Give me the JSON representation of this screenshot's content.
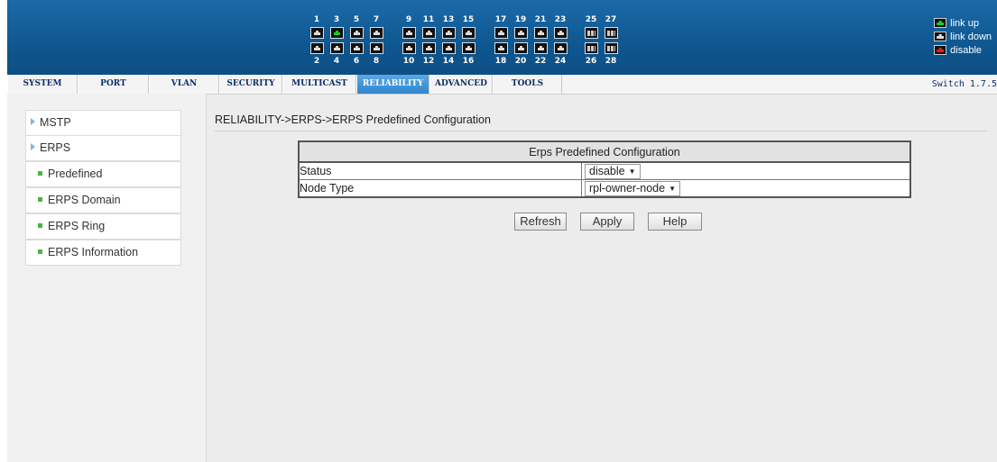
{
  "header": {
    "ports_top": [
      {
        "num": "1",
        "state": "down"
      },
      {
        "num": "3",
        "state": "up"
      },
      {
        "num": "5",
        "state": "down"
      },
      {
        "num": "7",
        "state": "down"
      },
      {
        "num": "9",
        "state": "down"
      },
      {
        "num": "11",
        "state": "down"
      },
      {
        "num": "13",
        "state": "down"
      },
      {
        "num": "15",
        "state": "down"
      },
      {
        "num": "17",
        "state": "down"
      },
      {
        "num": "19",
        "state": "down"
      },
      {
        "num": "21",
        "state": "down"
      },
      {
        "num": "23",
        "state": "down"
      },
      {
        "num": "25",
        "state": "sfp"
      },
      {
        "num": "27",
        "state": "sfp"
      }
    ],
    "ports_bottom": [
      {
        "num": "2",
        "state": "down"
      },
      {
        "num": "4",
        "state": "down"
      },
      {
        "num": "6",
        "state": "down"
      },
      {
        "num": "8",
        "state": "down"
      },
      {
        "num": "10",
        "state": "down"
      },
      {
        "num": "12",
        "state": "down"
      },
      {
        "num": "14",
        "state": "down"
      },
      {
        "num": "16",
        "state": "down"
      },
      {
        "num": "18",
        "state": "down"
      },
      {
        "num": "20",
        "state": "down"
      },
      {
        "num": "22",
        "state": "down"
      },
      {
        "num": "24",
        "state": "down"
      },
      {
        "num": "26",
        "state": "sfp"
      },
      {
        "num": "28",
        "state": "sfp"
      }
    ],
    "legend": {
      "link_up": "link up",
      "link_down": "link down",
      "disable": "disable"
    }
  },
  "menu": {
    "items": [
      "SYSTEM",
      "PORT",
      "VLAN",
      "SECURITY",
      "MULTICAST",
      "RELIABILITY",
      "ADVANCED",
      "TOOLS"
    ],
    "active": "RELIABILITY",
    "version": "Switch 1.7.5"
  },
  "sidebar": {
    "items": [
      {
        "label": "MSTP",
        "type": "section"
      },
      {
        "label": "ERPS",
        "type": "section"
      },
      {
        "label": "Predefined",
        "type": "sub"
      },
      {
        "label": "ERPS Domain",
        "type": "sub"
      },
      {
        "label": "ERPS Ring",
        "type": "sub"
      },
      {
        "label": "ERPS Information",
        "type": "sub"
      }
    ]
  },
  "main": {
    "breadcrumb": "RELIABILITY->ERPS->ERPS Predefined Configuration",
    "table": {
      "title": "Erps Predefined Configuration",
      "rows": [
        {
          "label": "Status",
          "value": "disable"
        },
        {
          "label": "Node Type",
          "value": "rpl-owner-node"
        }
      ]
    },
    "buttons": {
      "refresh": "Refresh",
      "apply": "Apply",
      "help": "Help"
    }
  },
  "colors": {
    "header_blue": "#0f5790",
    "active_tab": "#3a8fd6",
    "link_up": "#19d11f",
    "disable": "#e02020"
  }
}
